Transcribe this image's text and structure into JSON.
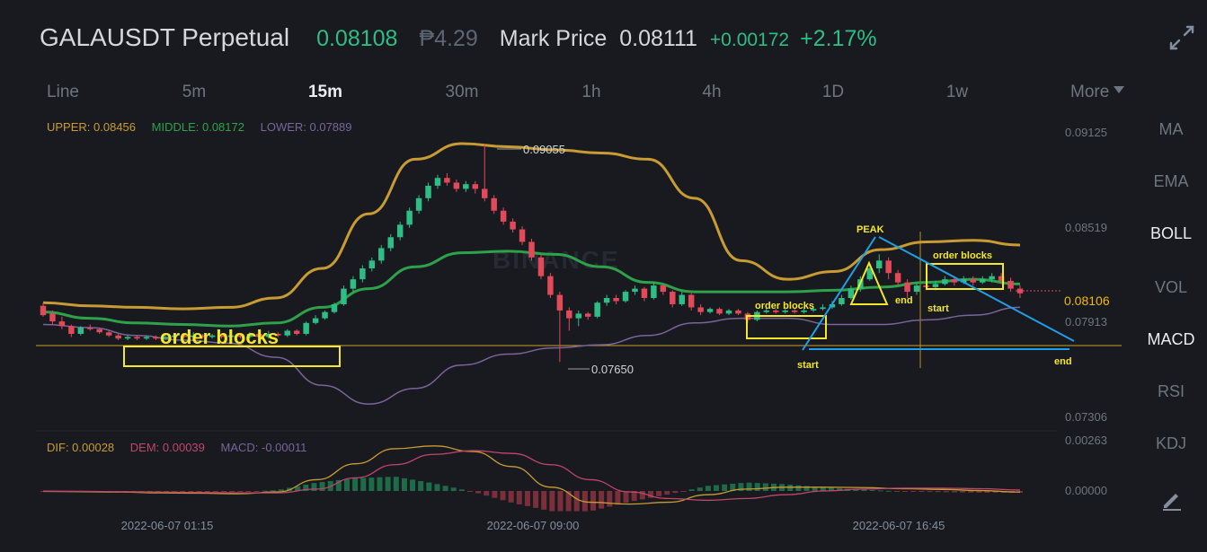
{
  "header": {
    "symbol": "GALAUSDT Perpetual",
    "last_price": "0.08108",
    "fiat_price": "₱4.29",
    "mark_label": "Mark Price",
    "mark_price": "0.08111",
    "change_abs": "+0.00172",
    "change_pct": "+2.17%",
    "icon": "expand-icon"
  },
  "intervals": [
    {
      "label": "Line",
      "active": false
    },
    {
      "label": "5m",
      "active": false
    },
    {
      "label": "15m",
      "active": true
    },
    {
      "label": "30m",
      "active": false
    },
    {
      "label": "1h",
      "active": false
    },
    {
      "label": "4h",
      "active": false
    },
    {
      "label": "1D",
      "active": false
    },
    {
      "label": "1w",
      "active": false
    }
  ],
  "more_label": "More",
  "indicator_menu": [
    "MA",
    "EMA",
    "BOLL",
    "VOL",
    "MACD",
    "RSI",
    "KDJ"
  ],
  "active_indicators": [
    "BOLL",
    "MACD"
  ],
  "boll_legend": {
    "upper": "UPPER: 0.08456",
    "middle": "MIDDLE: 0.08172",
    "lower": "LOWER: 0.07889"
  },
  "macd_legend": {
    "dif": "DIF: 0.00028",
    "dem": "DEM: 0.00039",
    "macd": "MACD: -0.00011"
  },
  "colors": {
    "up": "#2ebd85",
    "down": "#e04a59",
    "upper": "#c89c32",
    "middle": "#2ea24a",
    "lower": "#7a6499",
    "annotation": "#f5e72a",
    "trendline": "#1fa0e6",
    "current_line": "#c99e27"
  },
  "watermark": "BINANCE",
  "chart_data": {
    "type": "candlestick",
    "interval": "15m",
    "time_labels": [
      "2022-06-07 01:15",
      "2022-06-07 09:00",
      "2022-06-07 16:45"
    ],
    "price_axis_labels": [
      "0.09125",
      "0.08519",
      "0.08106",
      "0.07913",
      "0.07306"
    ],
    "macd_axis_labels": [
      "0.00263",
      "0.00000"
    ],
    "current_price": 0.08106,
    "high_marker": "0.09055",
    "low_marker": "0.07650",
    "candles": [
      [
        0.0801,
        0.0795,
        0.0803,
        0.0794
      ],
      [
        0.0796,
        0.0791,
        0.0798,
        0.0789
      ],
      [
        0.0791,
        0.0788,
        0.0794,
        0.0786
      ],
      [
        0.0788,
        0.0783,
        0.0789,
        0.0781
      ],
      [
        0.0783,
        0.0787,
        0.0788,
        0.0782
      ],
      [
        0.0787,
        0.0786,
        0.0789,
        0.0785
      ],
      [
        0.0786,
        0.0784,
        0.0787,
        0.0783
      ],
      [
        0.0784,
        0.0782,
        0.0785,
        0.0781
      ],
      [
        0.0782,
        0.078,
        0.0783,
        0.0779
      ],
      [
        0.078,
        0.0781,
        0.0782,
        0.0779
      ],
      [
        0.0781,
        0.078,
        0.0782,
        0.0779
      ],
      [
        0.078,
        0.0781,
        0.0782,
        0.0779
      ],
      [
        0.0781,
        0.078,
        0.0782,
        0.0779
      ],
      [
        0.078,
        0.0781,
        0.0783,
        0.0779
      ],
      [
        0.0781,
        0.0782,
        0.0783,
        0.078
      ],
      [
        0.0782,
        0.0781,
        0.0783,
        0.078
      ],
      [
        0.0781,
        0.0782,
        0.0784,
        0.078
      ],
      [
        0.0782,
        0.0781,
        0.0783,
        0.078
      ],
      [
        0.0781,
        0.0782,
        0.0783,
        0.078
      ],
      [
        0.0782,
        0.0781,
        0.0783,
        0.078
      ],
      [
        0.0781,
        0.0782,
        0.0783,
        0.078
      ],
      [
        0.0782,
        0.0781,
        0.0783,
        0.078
      ],
      [
        0.0781,
        0.0783,
        0.0784,
        0.078
      ],
      [
        0.0783,
        0.0781,
        0.0784,
        0.0779
      ],
      [
        0.0781,
        0.0783,
        0.0785,
        0.078
      ],
      [
        0.0783,
        0.0782,
        0.0784,
        0.0781
      ],
      [
        0.0782,
        0.0785,
        0.0786,
        0.0781
      ],
      [
        0.0785,
        0.0783,
        0.0786,
        0.0782
      ],
      [
        0.0783,
        0.079,
        0.0791,
        0.0782
      ],
      [
        0.079,
        0.0793,
        0.0795,
        0.0789
      ],
      [
        0.0793,
        0.0797,
        0.0798,
        0.0792
      ],
      [
        0.0797,
        0.0802,
        0.0803,
        0.0796
      ],
      [
        0.0802,
        0.0812,
        0.0814,
        0.0801
      ],
      [
        0.0812,
        0.0818,
        0.082,
        0.081
      ],
      [
        0.0818,
        0.0825,
        0.0827,
        0.0816
      ],
      [
        0.0825,
        0.083,
        0.0832,
        0.0823
      ],
      [
        0.083,
        0.0838,
        0.084,
        0.0828
      ],
      [
        0.0838,
        0.0845,
        0.0847,
        0.0836
      ],
      [
        0.0845,
        0.0853,
        0.0855,
        0.0843
      ],
      [
        0.0853,
        0.0862,
        0.0864,
        0.0851
      ],
      [
        0.0862,
        0.087,
        0.0872,
        0.086
      ],
      [
        0.087,
        0.0878,
        0.088,
        0.0868
      ],
      [
        0.0878,
        0.0883,
        0.0885,
        0.0876
      ],
      [
        0.0883,
        0.088,
        0.0886,
        0.0878
      ],
      [
        0.088,
        0.0876,
        0.0882,
        0.0874
      ],
      [
        0.0876,
        0.0879,
        0.0881,
        0.0874
      ],
      [
        0.0879,
        0.0876,
        0.0881,
        0.0873
      ],
      [
        0.0876,
        0.087,
        0.0905,
        0.0868
      ],
      [
        0.087,
        0.0862,
        0.0872,
        0.086
      ],
      [
        0.0862,
        0.0855,
        0.0864,
        0.0853
      ],
      [
        0.0855,
        0.085,
        0.0857,
        0.0848
      ],
      [
        0.085,
        0.0842,
        0.0852,
        0.084
      ],
      [
        0.0842,
        0.0832,
        0.0844,
        0.083
      ],
      [
        0.0832,
        0.082,
        0.0834,
        0.0818
      ],
      [
        0.082,
        0.0808,
        0.0822,
        0.0806
      ],
      [
        0.0808,
        0.0798,
        0.081,
        0.0765
      ],
      [
        0.0798,
        0.0793,
        0.08,
        0.0785
      ],
      [
        0.0793,
        0.0796,
        0.0798,
        0.0788
      ],
      [
        0.0796,
        0.0794,
        0.0797,
        0.0792
      ],
      [
        0.0794,
        0.0803,
        0.0804,
        0.0793
      ],
      [
        0.0803,
        0.0806,
        0.0808,
        0.0801
      ],
      [
        0.0806,
        0.0804,
        0.0808,
        0.0802
      ],
      [
        0.0804,
        0.081,
        0.0811,
        0.0803
      ],
      [
        0.081,
        0.0812,
        0.0814,
        0.0808
      ],
      [
        0.0812,
        0.0806,
        0.0813,
        0.0804
      ],
      [
        0.0806,
        0.0814,
        0.0816,
        0.0805
      ],
      [
        0.0814,
        0.081,
        0.0815,
        0.0808
      ],
      [
        0.081,
        0.0802,
        0.0811,
        0.08
      ],
      [
        0.0802,
        0.0808,
        0.081,
        0.0801
      ],
      [
        0.0808,
        0.08,
        0.0809,
        0.0798
      ],
      [
        0.08,
        0.0797,
        0.0802,
        0.0795
      ],
      [
        0.0797,
        0.0799,
        0.08,
        0.0796
      ],
      [
        0.0799,
        0.0796,
        0.08,
        0.0795
      ],
      [
        0.0796,
        0.0798,
        0.0799,
        0.0795
      ],
      [
        0.0798,
        0.0796,
        0.0799,
        0.0795
      ],
      [
        0.0796,
        0.0792,
        0.0797,
        0.079
      ],
      [
        0.0792,
        0.0797,
        0.0798,
        0.0791
      ],
      [
        0.0797,
        0.0798,
        0.08,
        0.0796
      ],
      [
        0.0798,
        0.0797,
        0.0799,
        0.0796
      ],
      [
        0.0797,
        0.0798,
        0.0799,
        0.0796
      ],
      [
        0.0798,
        0.0797,
        0.0799,
        0.0796
      ],
      [
        0.0797,
        0.0798,
        0.08,
        0.0796
      ],
      [
        0.0798,
        0.0799,
        0.08,
        0.0797
      ],
      [
        0.0799,
        0.08,
        0.0802,
        0.0798
      ],
      [
        0.08,
        0.0802,
        0.0804,
        0.0799
      ],
      [
        0.0802,
        0.0806,
        0.0808,
        0.0801
      ],
      [
        0.0806,
        0.0812,
        0.0814,
        0.0805
      ],
      [
        0.0812,
        0.0818,
        0.082,
        0.081
      ],
      [
        0.0818,
        0.0825,
        0.0828,
        0.0817
      ],
      [
        0.0825,
        0.083,
        0.0834,
        0.0822
      ],
      [
        0.083,
        0.0822,
        0.0832,
        0.0818
      ],
      [
        0.0822,
        0.0816,
        0.0824,
        0.0814
      ],
      [
        0.0816,
        0.081,
        0.0818,
        0.0806
      ],
      [
        0.081,
        0.0814,
        0.0816,
        0.0808
      ],
      [
        0.0814,
        0.0813,
        0.0816,
        0.0811
      ],
      [
        0.0813,
        0.0815,
        0.0817,
        0.0811
      ],
      [
        0.0815,
        0.0818,
        0.082,
        0.0814
      ],
      [
        0.0818,
        0.0816,
        0.082,
        0.0814
      ],
      [
        0.0816,
        0.0818,
        0.082,
        0.0815
      ],
      [
        0.0818,
        0.0816,
        0.082,
        0.0814
      ],
      [
        0.0816,
        0.0818,
        0.082,
        0.0815
      ],
      [
        0.0818,
        0.082,
        0.0822,
        0.0816
      ],
      [
        0.082,
        0.0817,
        0.0822,
        0.0815
      ],
      [
        0.0817,
        0.0812,
        0.0819,
        0.081
      ],
      [
        0.0812,
        0.0809,
        0.0814,
        0.0806
      ]
    ],
    "boll": {
      "upper": [
        0.0803,
        0.0801,
        0.08,
        0.0799,
        0.08,
        0.0806,
        0.0825,
        0.086,
        0.0895,
        0.0905,
        0.0903,
        0.0901,
        0.0899,
        0.0895,
        0.087,
        0.083,
        0.0818,
        0.0823,
        0.0837,
        0.0842,
        0.0843,
        0.084
      ],
      "middle": [
        0.0797,
        0.0793,
        0.079,
        0.0789,
        0.0788,
        0.079,
        0.08,
        0.0812,
        0.0826,
        0.0835,
        0.0836,
        0.0834,
        0.0826,
        0.0816,
        0.081,
        0.081,
        0.081,
        0.0811,
        0.0813,
        0.0816,
        0.0818,
        0.0815
      ],
      "lower": [
        0.0789,
        0.0787,
        0.0782,
        0.0779,
        0.0777,
        0.0768,
        0.075,
        0.0738,
        0.0748,
        0.0763,
        0.077,
        0.0774,
        0.0776,
        0.0782,
        0.079,
        0.0793,
        0.0793,
        0.0789,
        0.0789,
        0.0792,
        0.0795,
        0.08
      ]
    },
    "macd": {
      "dif": [
        -2e-05,
        -4e-05,
        -6e-05,
        -0.0001,
        -0.00012,
        -0.00015,
        -5e-05,
        0.0006,
        0.00145,
        0.00225,
        0.0024,
        0.0021,
        0.0013,
        0.0002,
        -0.0006,
        -0.0007,
        -0.0006,
        -0.0002,
        0.0001,
        0.0002,
        0.0002,
        0.00018,
        0.00012,
        8e-05,
        2e-05,
        -6e-05
      ],
      "dem": [
        -1e-05,
        -2e-05,
        -4e-05,
        -6e-05,
        -8e-05,
        -0.0001,
        -0.0001,
        0.0001,
        0.0007,
        0.0014,
        0.00195,
        0.00215,
        0.002,
        0.0014,
        0.0006,
        -5e-05,
        -0.0004,
        -0.0005,
        -0.0004,
        -0.0002,
        0.0,
        0.0001,
        0.00015,
        0.00015,
        0.00012,
        5e-05
      ]
    }
  },
  "annotations": {
    "order_blocks_big": "order blocks",
    "order_blocks_mid": "order blocks",
    "order_blocks_right": "order blocks",
    "peak": "PEAK",
    "start_1": "start",
    "end_1": "end",
    "start_2": "start",
    "end_2": "end"
  }
}
